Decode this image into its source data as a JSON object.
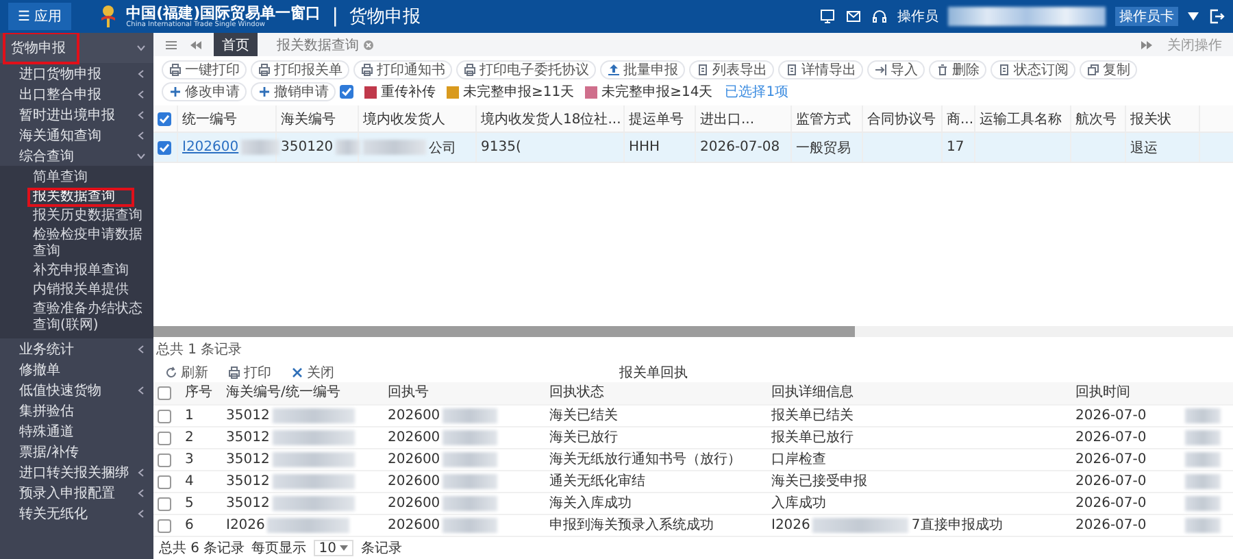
{
  "header": {
    "app_button": "应用",
    "menu_glyph": "☰",
    "title": "中国(福建)国际贸易单一窗口",
    "subtitle": "China International Trade Single Window",
    "separator": "|",
    "module": "货物申报",
    "operator_label": "操作员",
    "badge": "操作员卡"
  },
  "sidebar": {
    "items": [
      {
        "label": "货物申报",
        "kind": "head",
        "expanded": true,
        "highlighted": true
      },
      {
        "label": "进口货物申报",
        "kind": "group",
        "expanded": false
      },
      {
        "label": "出口整合申报",
        "kind": "group",
        "expanded": false
      },
      {
        "label": "暂时进出境申报",
        "kind": "group",
        "expanded": false
      },
      {
        "label": "海关通知查询",
        "kind": "group",
        "expanded": false
      },
      {
        "label": "综合查询",
        "kind": "group",
        "expanded": true,
        "children": [
          {
            "label": "简单查询",
            "selected": false,
            "highlighted": false
          },
          {
            "label": "报关数据查询",
            "selected": true,
            "highlighted": true
          },
          {
            "label": "报关历史数据查询",
            "selected": false,
            "highlighted": false
          },
          {
            "label": "检验检疫申请数据查询",
            "selected": false,
            "highlighted": false
          },
          {
            "label": "补充申报单查询",
            "selected": false,
            "highlighted": false
          },
          {
            "label": "内销报关单提供",
            "selected": false,
            "highlighted": false
          },
          {
            "label": "查验准备办结状态查询(联网)",
            "selected": false,
            "highlighted": false
          }
        ]
      },
      {
        "label": "业务统计",
        "kind": "group",
        "expanded": false
      },
      {
        "label": "修撤单",
        "kind": "leaf"
      },
      {
        "label": "低值快速货物",
        "kind": "group",
        "expanded": false
      },
      {
        "label": "集拼验估",
        "kind": "leaf"
      },
      {
        "label": "特殊通道",
        "kind": "leaf"
      },
      {
        "label": "票据/补传",
        "kind": "leaf"
      },
      {
        "label": "进口转关报关捆绑",
        "kind": "group",
        "expanded": false
      },
      {
        "label": "预录入申报配置",
        "kind": "group",
        "expanded": false
      },
      {
        "label": "转关无纸化",
        "kind": "group",
        "expanded": false
      }
    ]
  },
  "tabs": [
    {
      "label": "首页",
      "selected": true,
      "closable": false
    },
    {
      "label": "报关数据查询",
      "selected": false,
      "closable": true
    }
  ],
  "tab_actions": {
    "close_label": "关闭操作"
  },
  "toolbar": {
    "buttons": [
      {
        "label": "一键打印"
      },
      {
        "label": "打印报关单"
      },
      {
        "label": "打印通知书"
      },
      {
        "label": "打印电子委托协议"
      },
      {
        "label": "批量申报"
      },
      {
        "label": "列表导出"
      },
      {
        "label": "详情导出"
      },
      {
        "label": "导入"
      },
      {
        "label": "删除"
      },
      {
        "label": "状态订阅"
      },
      {
        "label": "复制"
      },
      {
        "label": "修改申请"
      },
      {
        "label": "撤销申请"
      }
    ],
    "filter_checked": true,
    "legend": [
      {
        "label": "重传补传",
        "color": "#c0394b"
      },
      {
        "label": "未完整申报≥11天",
        "color": "#d99a1e"
      },
      {
        "label": "未完整申报≥14天",
        "color": "#cf6f8c"
      }
    ],
    "selection_note": "已选择1项"
  },
  "table": {
    "all_checked": true,
    "columns": [
      "统一编号",
      "海关编号",
      "境内收发货人",
      "境内收发货人18位社...",
      "提运单号",
      "进出口...",
      "监管方式",
      "合同协议号",
      "商...",
      "运输工具名称",
      "航次号",
      "报关状"
    ],
    "rows": [
      {
        "checked": true,
        "selected": true,
        "cells": [
          "I202600",
          "350120",
          "公司",
          "9135(",
          "HHH",
          "2026-07-08",
          "一般贸易",
          "",
          "17",
          "",
          "",
          "退运"
        ]
      }
    ],
    "total": "总共 1 条记录"
  },
  "receipts": {
    "title": "报关单回执",
    "all_checked": false,
    "buttons": [
      {
        "label": "刷新"
      },
      {
        "label": "打印"
      },
      {
        "label": "关闭"
      }
    ],
    "columns": [
      "序号",
      "海关编号/统一编号",
      "回执号",
      "回执状态",
      "回执详细信息",
      "回执时间"
    ],
    "rows": [
      {
        "checked": false,
        "seq": "1",
        "customs_no": "35012",
        "receipt_no": "202600",
        "status": "海关已结关",
        "detail": "报关单已结关",
        "time": "2026-07-0"
      },
      {
        "checked": false,
        "seq": "2",
        "customs_no": "35012",
        "receipt_no": "202600",
        "status": "海关已放行",
        "detail": "报关单已放行",
        "time": "2026-07-0"
      },
      {
        "checked": false,
        "seq": "3",
        "customs_no": "35012",
        "receipt_no": "202600",
        "status": "海关无纸放行通知书号（放行）",
        "detail": "口岸检查",
        "time": "2026-07-0"
      },
      {
        "checked": false,
        "seq": "4",
        "customs_no": "35012",
        "receipt_no": "202600",
        "status": "通关无纸化审结",
        "detail": "海关已接受申报",
        "time": "2026-07-0"
      },
      {
        "checked": false,
        "seq": "5",
        "customs_no": "35012",
        "receipt_no": "202600",
        "status": "海关入库成功",
        "detail": "入库成功",
        "time": "2026-07-0"
      },
      {
        "checked": false,
        "seq": "6",
        "customs_no": "I2026",
        "receipt_no": "202600",
        "status": "申报到海关预录入系统成功",
        "detail": "I2026",
        "detail_tail": "7直接申报成功",
        "time": "2026-07-0"
      }
    ],
    "footer": {
      "total": "总共 6 条记录",
      "per_page_label": "每页显示",
      "per_page": "10",
      "unit": "条记录"
    }
  }
}
